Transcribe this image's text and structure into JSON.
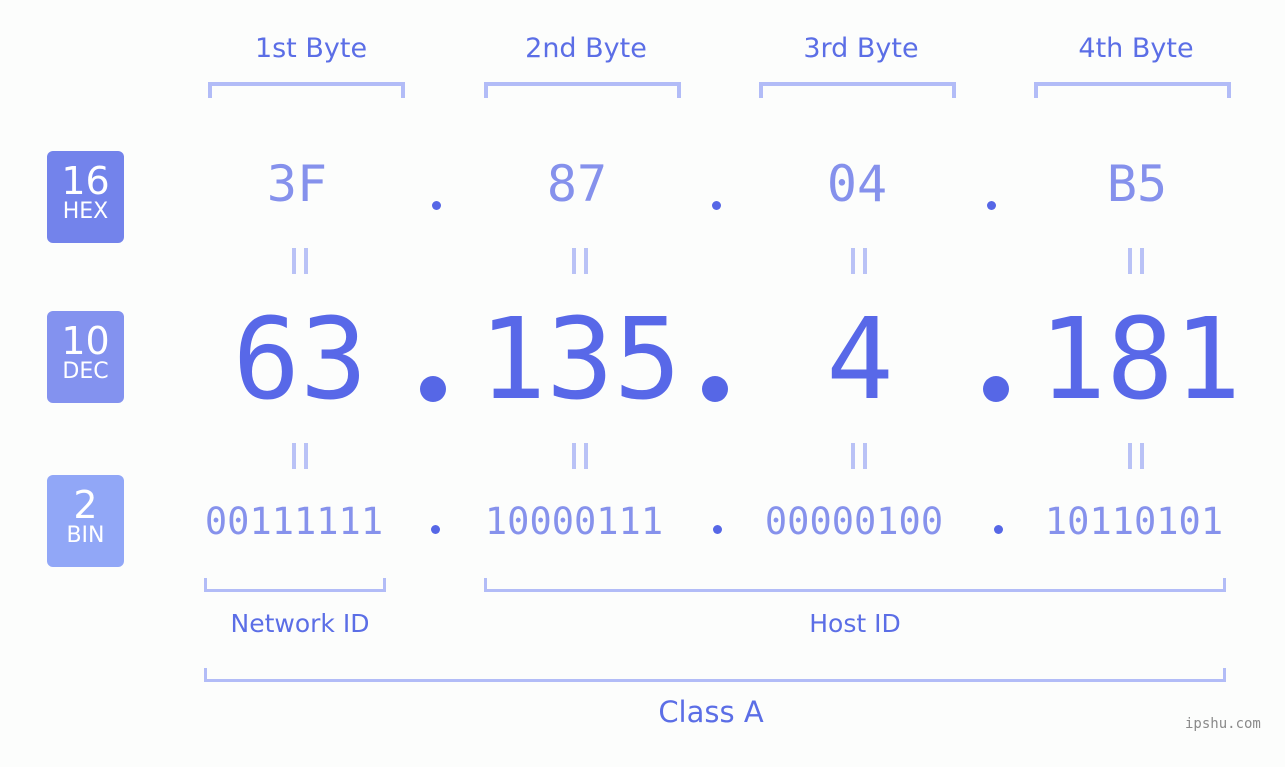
{
  "bytes": {
    "labels": [
      "1st Byte",
      "2nd Byte",
      "3rd Byte",
      "4th Byte"
    ],
    "hex": [
      "3F",
      "87",
      "04",
      "B5"
    ],
    "dec": [
      "63",
      "135",
      "4",
      "181"
    ],
    "bin": [
      "00111111",
      "10000111",
      "00000100",
      "10110101"
    ]
  },
  "badges": {
    "hex": {
      "base": "16",
      "label": "HEX",
      "color": "#7383eb"
    },
    "dec": {
      "base": "10",
      "label": "DEC",
      "color": "#8392ef"
    },
    "bin": {
      "base": "2",
      "label": "BIN",
      "color": "#91a7f7"
    }
  },
  "sections": {
    "network": "Network ID",
    "host": "Host ID",
    "class": "Class A"
  },
  "watermark": "ipshu.com",
  "colors": {
    "accent": "#5868e8",
    "bracket": "#b2bcf7",
    "light_text": "#8591ec"
  }
}
